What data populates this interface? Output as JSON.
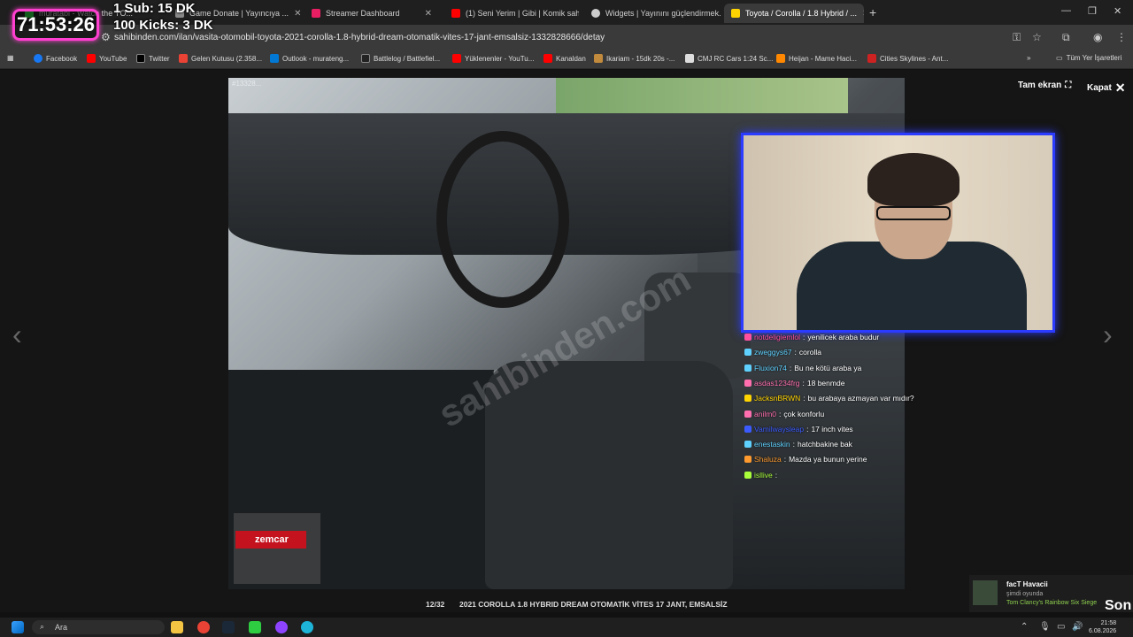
{
  "browser": {
    "tabs": [
      {
        "label": "muratabi  - Watch the YO...",
        "color": "#2ecc40",
        "active": false
      },
      {
        "label": "Game Donate | Yayıncıya ...",
        "color": "#888888",
        "active": false
      },
      {
        "label": "Streamer Dashboard",
        "color": "#e91e63",
        "active": false
      },
      {
        "label": "(1) Seni Yerim | Gibi | Komik sah...",
        "color": "#ff0000",
        "active": false
      },
      {
        "label": "Widgets | Yayınını güçlendirmek...",
        "color": "#cccccc",
        "active": false
      },
      {
        "label": "Toyota / Corolla / 1.8 Hybrid / ...",
        "color": "#ffd400",
        "active": true
      }
    ],
    "url": "sahibinden.com/ilan/vasita-otomobil-toyota-2021-corolla-1.8-hybrid-dream-otomatik-vites-17-jant-emsalsiz-1332828666/detay",
    "bookmarks": [
      {
        "label": "Facebook",
        "color": "#1877f2"
      },
      {
        "label": "YouTube",
        "color": "#ff0000"
      },
      {
        "label": "Twitter",
        "color": "#000000"
      },
      {
        "label": "Gelen Kutusu (2.358...",
        "color": "#ea4335"
      },
      {
        "label": "Outlook - murateng...",
        "color": "#0078d4"
      },
      {
        "label": "Battlelog / Battlefiel...",
        "color": "#222222"
      },
      {
        "label": "Yüklenenler - YouTu...",
        "color": "#ff0000"
      },
      {
        "label": "Kanaldan",
        "color": "#ff0000"
      },
      {
        "label": "Ikariam - 15dk 20s -...",
        "color": "#c28a3c"
      },
      {
        "label": "CMJ RC Cars 1:24 Sc...",
        "color": "#dddddd"
      },
      {
        "label": "Heijan - Mame Haci...",
        "color": "#ff8800"
      },
      {
        "label": "Cities Skylines - Ant...",
        "color": "#cc2222"
      }
    ],
    "all_bookmarks": "Tüm Yer İşaretleri"
  },
  "overlay": {
    "timer": "71:53:26",
    "sub_line": "1 Sub: 15 DK",
    "kicks_line": "100 Kicks: 3 DK",
    "timer_color": "#ff3fd0"
  },
  "viewer": {
    "photo_tag": "#13328...",
    "watermark": "sahibinden.com",
    "brand_badge": "zemcar",
    "fullscreen_label": "Tam ekran",
    "close_label": "Kapat",
    "counter": "12/32",
    "title": "2021 COROLLA 1.8 HYBRID DREAM OTOMATİK VİTES 17 JANT, EMSALSİZ"
  },
  "chat": [
    {
      "user": "notdeligiemlol",
      "msg": "yenilicek araba budur",
      "color": "#ff4fa0"
    },
    {
      "user": "zweggys67",
      "msg": "corolla",
      "color": "#5fd1ff"
    },
    {
      "user": "Fluxion74",
      "msg": "Bu ne kötü araba ya",
      "color": "#5fd1ff"
    },
    {
      "user": "asdas1234frg",
      "msg": "18 benmde",
      "color": "#ff6fb0"
    },
    {
      "user": "JacksnBRWN",
      "msg": "bu arabaya azmayan var mıdır?",
      "color": "#ffd400"
    },
    {
      "user": "anilm0",
      "msg": "çok konforlu",
      "color": "#ff6fb0"
    },
    {
      "user": "Vamilwaysleap",
      "msg": "17 inch vites",
      "color": "#3b5bff"
    },
    {
      "user": "enestaskin",
      "msg": "hatchbakine bak",
      "color": "#5fd1ff"
    },
    {
      "user": "Shaluza",
      "msg": "Mazda ya bunun yerine",
      "color": "#ff9a2e"
    },
    {
      "user": "isllive",
      "msg": "",
      "color": "#aaff3b"
    }
  ],
  "notification": {
    "name": "facT Havacii",
    "status": "şimdi oyunda",
    "game": "Tom Clancy's Rainbow Six Siege",
    "partial": "Son"
  },
  "taskbar": {
    "search_placeholder": "Ara",
    "time": "21:58",
    "date": "6.08.2026"
  }
}
